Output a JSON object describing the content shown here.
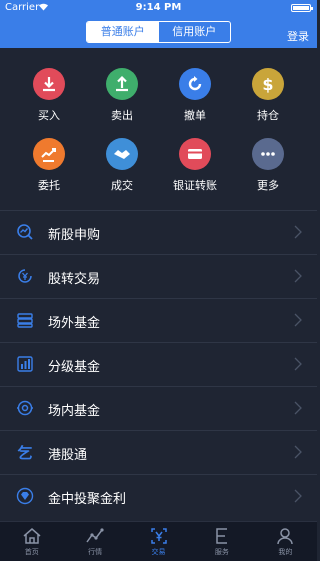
{
  "status_bar": {
    "carrier": "Carrier",
    "time": "9:14 PM"
  },
  "header": {
    "segments": [
      "普通账户",
      "信用账户"
    ],
    "active_segment": "普通账户",
    "login_label": "登录",
    "accent_color": "#3a7ee8"
  },
  "actions": [
    {
      "label": "买入",
      "icon": "download-arrow-icon",
      "color": "#e14b5a"
    },
    {
      "label": "卖出",
      "icon": "upload-arrow-icon",
      "color": "#3fae6c"
    },
    {
      "label": "撤单",
      "icon": "undo-circle-icon",
      "color": "#3a7ee8"
    },
    {
      "label": "持仓",
      "icon": "dollar-icon",
      "color": "#c9a53a"
    },
    {
      "label": "委托",
      "icon": "trend-hand-icon",
      "color": "#ef7a2e"
    },
    {
      "label": "成交",
      "icon": "handshake-icon",
      "color": "#3f8fd8"
    },
    {
      "label": "银证转账",
      "icon": "bank-card-icon",
      "color": "#e14b5a"
    },
    {
      "label": "更多",
      "icon": "more-dots-icon",
      "color": "#5a6a8f"
    }
  ],
  "menu": [
    {
      "label": "新股申购",
      "icon": "search-trend-icon"
    },
    {
      "label": "股转交易",
      "icon": "yen-cycle-icon"
    },
    {
      "label": "场外基金",
      "icon": "stack-icon"
    },
    {
      "label": "分级基金",
      "icon": "bar-chart-icon"
    },
    {
      "label": "场内基金",
      "icon": "target-icon"
    },
    {
      "label": "港股通",
      "icon": "hk-symbol-icon"
    },
    {
      "label": "金中投聚金利",
      "icon": "diamond-icon"
    }
  ],
  "tabs": [
    {
      "label": "首页",
      "icon": "home-icon",
      "active": false
    },
    {
      "label": "行情",
      "icon": "line-chart-icon",
      "active": false
    },
    {
      "label": "交易",
      "icon": "trade-yen-icon",
      "active": true
    },
    {
      "label": "服务",
      "icon": "service-e-icon",
      "active": false
    },
    {
      "label": "我的",
      "icon": "person-icon",
      "active": false
    }
  ]
}
